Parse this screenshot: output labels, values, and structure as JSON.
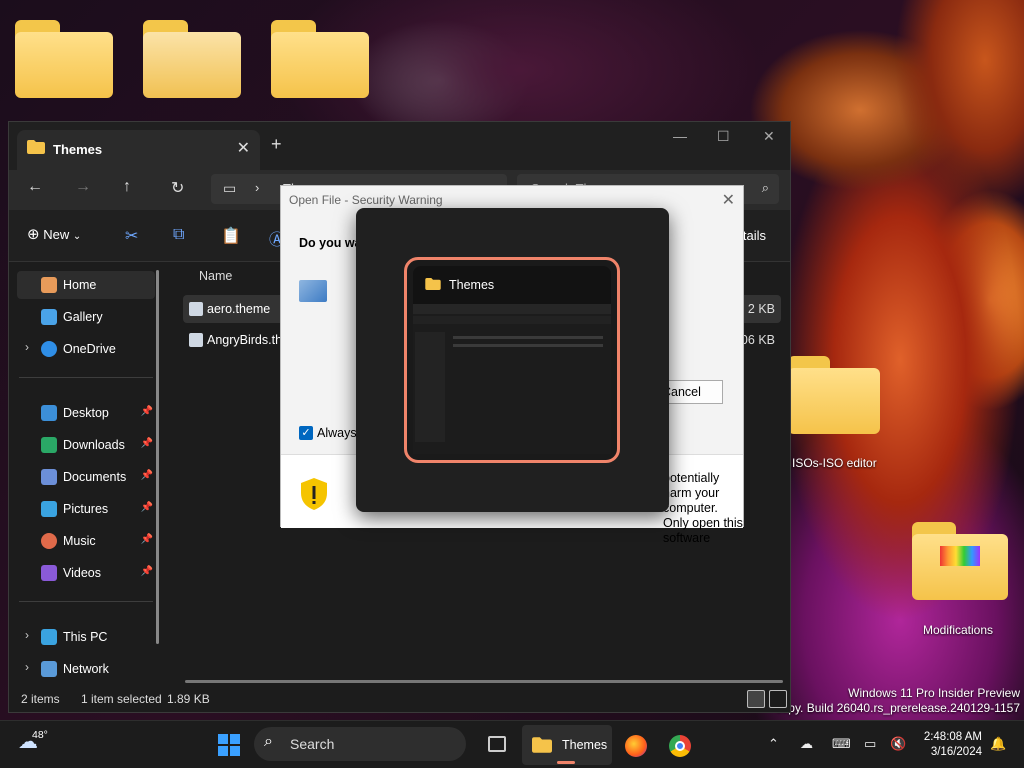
{
  "desktop": {
    "iso_editor_label": "ISOs-ISO editor",
    "modifications_label": "Modifications",
    "watermark_line1": "Windows 11 Pro Insider Preview",
    "watermark_line2": "copy. Build 26040.rs_prerelease.240129-1157"
  },
  "explorer": {
    "tab_title": "Themes",
    "address_text": "Themes",
    "search_placeholder": "Search Themes",
    "new_label": "New",
    "details_label": "Details",
    "sidebar": {
      "home": "Home",
      "gallery": "Gallery",
      "onedrive": "OneDrive",
      "desktop": "Desktop",
      "downloads": "Downloads",
      "documents": "Documents",
      "pictures": "Pictures",
      "music": "Music",
      "videos": "Videos",
      "this_pc": "This PC",
      "network": "Network"
    },
    "column_name": "Name",
    "files": [
      {
        "name": "aero.theme",
        "size": "2 KB"
      },
      {
        "name": "AngryBirds.theme",
        "size": "706 KB"
      }
    ],
    "status": {
      "items": "2 items",
      "selected": "1 item selected",
      "size": "1.89 KB"
    }
  },
  "dialog": {
    "title": "Open File - Security Warning",
    "question": "Do you want to open this file?",
    "cancel_label": "Cancel",
    "always_ask": "Always ask before opening this file",
    "warning_text": "potentially harm your computer. Only open this software"
  },
  "alttab": {
    "window_title": "Themes"
  },
  "taskbar": {
    "temperature": "48°",
    "search_label": "Search",
    "themes_label": "Themes",
    "time": "2:48:08 AM",
    "date": "3/16/2024"
  },
  "colors": {
    "accent": "#f0846a",
    "folder_yellow": "#f5c34a",
    "link_blue": "#0067c0"
  }
}
